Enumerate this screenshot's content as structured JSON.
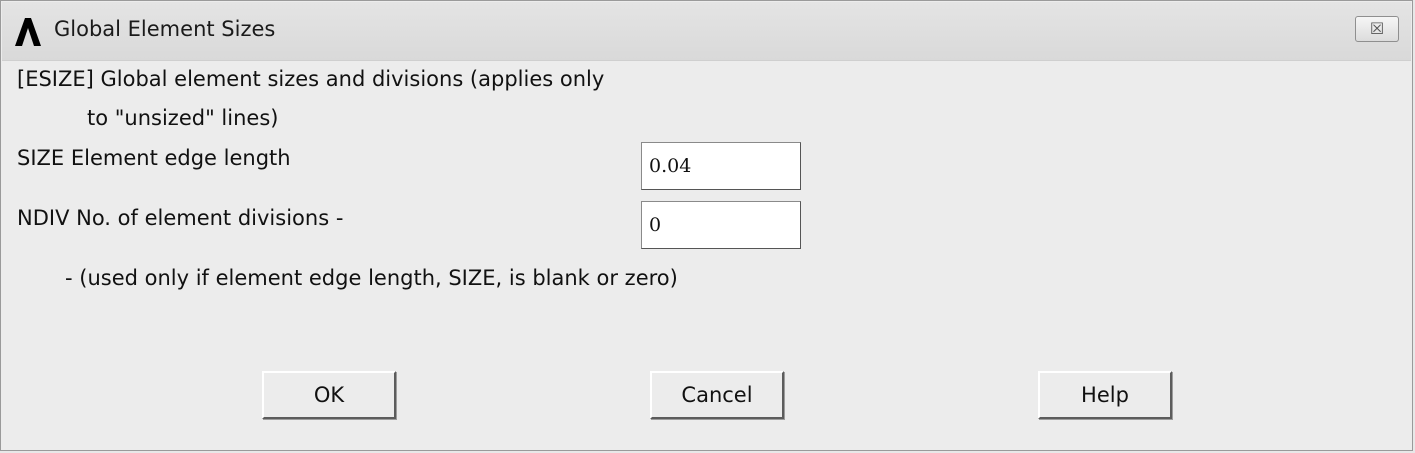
{
  "window": {
    "title": "Global Element Sizes",
    "close_label": "☒"
  },
  "description": {
    "line1": "[ESIZE]  Global element sizes and divisions (applies only",
    "line2": "to \"unsized\" lines)"
  },
  "size": {
    "label": "SIZE  Element edge length",
    "value": "0.04"
  },
  "ndiv": {
    "label": "NDIV  No. of element divisions -",
    "value": "0",
    "note": "- (used only if element edge length, SIZE, is blank or zero)"
  },
  "buttons": {
    "ok": "OK",
    "cancel": "Cancel",
    "help": "Help"
  }
}
